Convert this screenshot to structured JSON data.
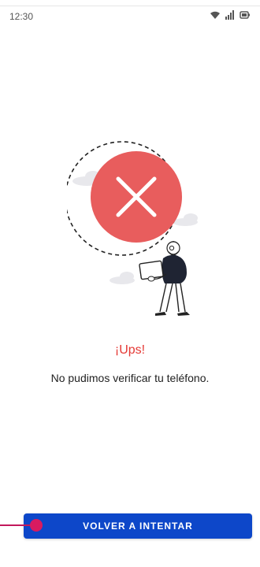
{
  "status_bar": {
    "time": "12:30",
    "icons": [
      "wifi-icon",
      "signal-icon",
      "battery-icon"
    ]
  },
  "illustration": {
    "description_icon": "error-x-icon",
    "accent_color": "#e85d5d"
  },
  "error": {
    "title": "¡Ups!",
    "message": "No pudimos verificar tu teléfono."
  },
  "actions": {
    "retry_label": "VOLVER A INTENTAR"
  },
  "colors": {
    "title": "#e53935",
    "primary_button": "#0d47c9",
    "touch_indicator": "#d81b60"
  }
}
